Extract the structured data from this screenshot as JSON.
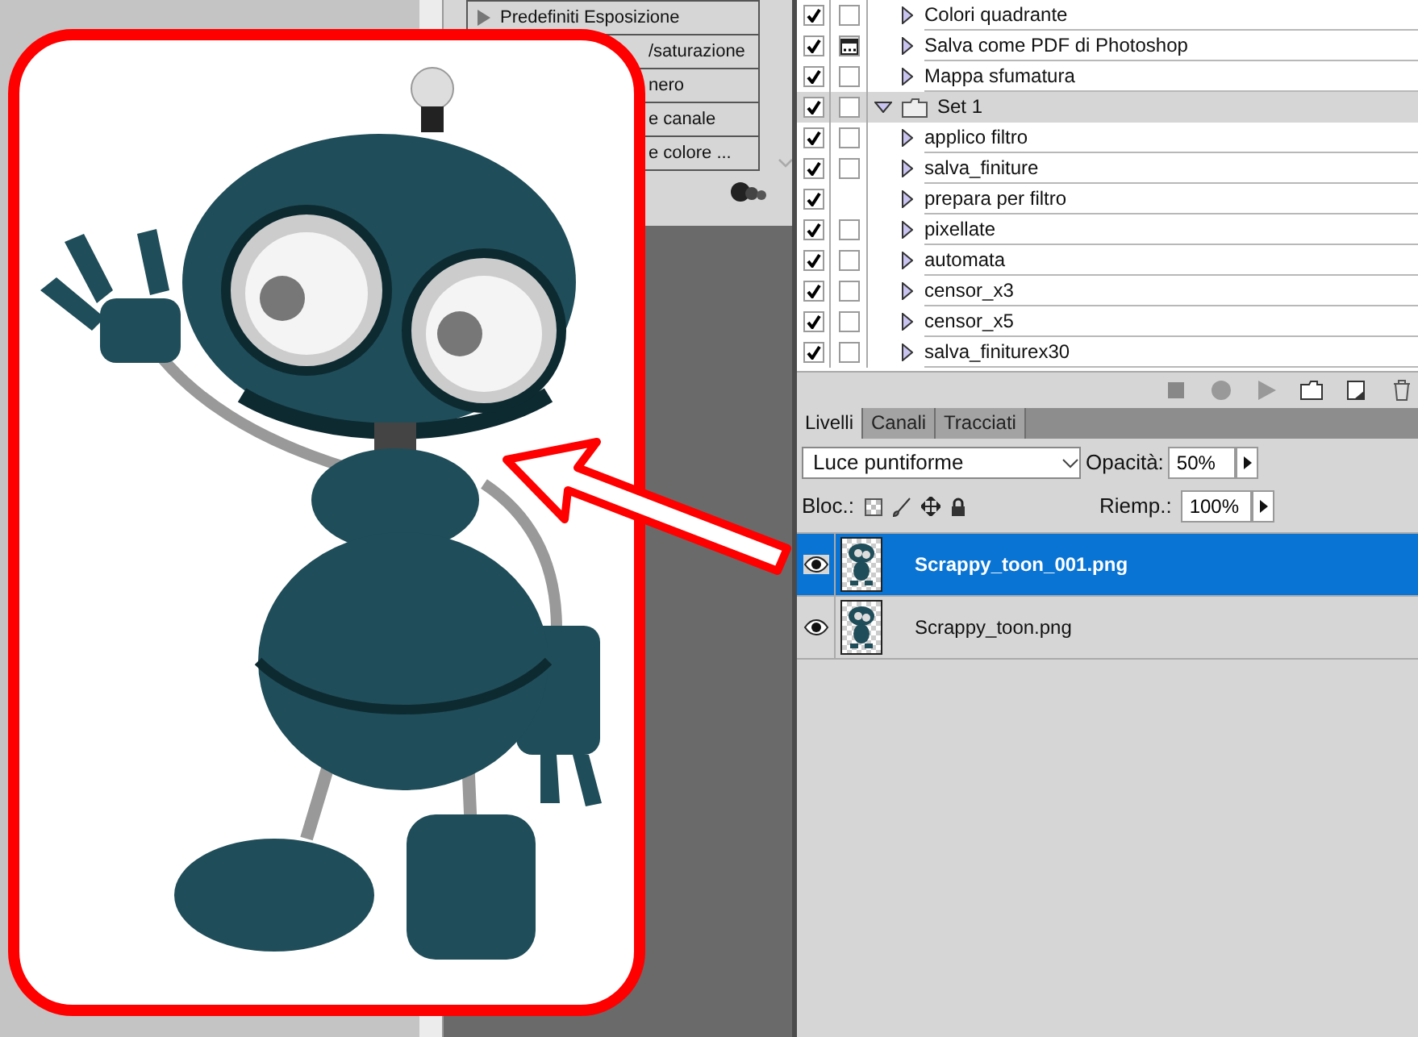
{
  "background_panel": {
    "items": [
      {
        "label": "Predefiniti Esposizione",
        "kind": "group"
      },
      {
        "label": "/saturazione",
        "kind": "covered"
      },
      {
        "label": "nero",
        "kind": "covered"
      },
      {
        "label": "e canale",
        "kind": "covered"
      },
      {
        "label": "e colore ...",
        "kind": "covered"
      }
    ]
  },
  "actions": {
    "items": [
      {
        "label": "Colori quadrante",
        "kind": "action",
        "enabled": true,
        "dialog_box": true,
        "dialog": false,
        "expanded": false
      },
      {
        "label": "Salva come PDF di Photoshop",
        "kind": "action",
        "enabled": true,
        "dialog_box": true,
        "dialog": true,
        "expanded": false
      },
      {
        "label": "Mappa sfumatura",
        "kind": "action",
        "enabled": true,
        "dialog_box": true,
        "dialog": false,
        "expanded": false
      },
      {
        "label": "Set 1",
        "kind": "set",
        "enabled": true,
        "dialog_box": true,
        "dialog": false,
        "expanded": true
      },
      {
        "label": "applico filtro",
        "kind": "action",
        "enabled": true,
        "dialog_box": true,
        "dialog": false,
        "expanded": false
      },
      {
        "label": "salva_finiture",
        "kind": "action",
        "enabled": true,
        "dialog_box": true,
        "dialog": false,
        "expanded": false
      },
      {
        "label": "prepara per filtro",
        "kind": "action",
        "enabled": true,
        "dialog_box": false,
        "expanded": false
      },
      {
        "label": "pixellate",
        "kind": "action",
        "enabled": true,
        "dialog_box": true,
        "dialog": false,
        "expanded": false
      },
      {
        "label": "automata",
        "kind": "action",
        "enabled": true,
        "dialog_box": true,
        "dialog": false,
        "expanded": false
      },
      {
        "label": "censor_x3",
        "kind": "action",
        "enabled": true,
        "dialog_box": true,
        "dialog": false,
        "expanded": false
      },
      {
        "label": "censor_x5",
        "kind": "action",
        "enabled": true,
        "dialog_box": true,
        "dialog": false,
        "expanded": false
      },
      {
        "label": "salva_finiturex30",
        "kind": "action",
        "enabled": true,
        "dialog_box": true,
        "dialog": false,
        "expanded": false
      }
    ]
  },
  "layers_panel": {
    "tabs": [
      {
        "label": "Livelli",
        "selected": true
      },
      {
        "label": "Canali",
        "selected": false
      },
      {
        "label": "Tracciati",
        "selected": false
      }
    ],
    "blend_mode": "Luce puntiforme",
    "opacity_label": "Opacità:",
    "opacity": "50%",
    "lock_label": "Bloc.:",
    "fill_label": "Riemp.:",
    "fill": "100%",
    "layers": [
      {
        "name": "Scrappy_toon_001.png",
        "selected": true,
        "visible": true
      },
      {
        "name": "Scrappy_toon.png",
        "selected": false,
        "visible": true
      }
    ]
  }
}
